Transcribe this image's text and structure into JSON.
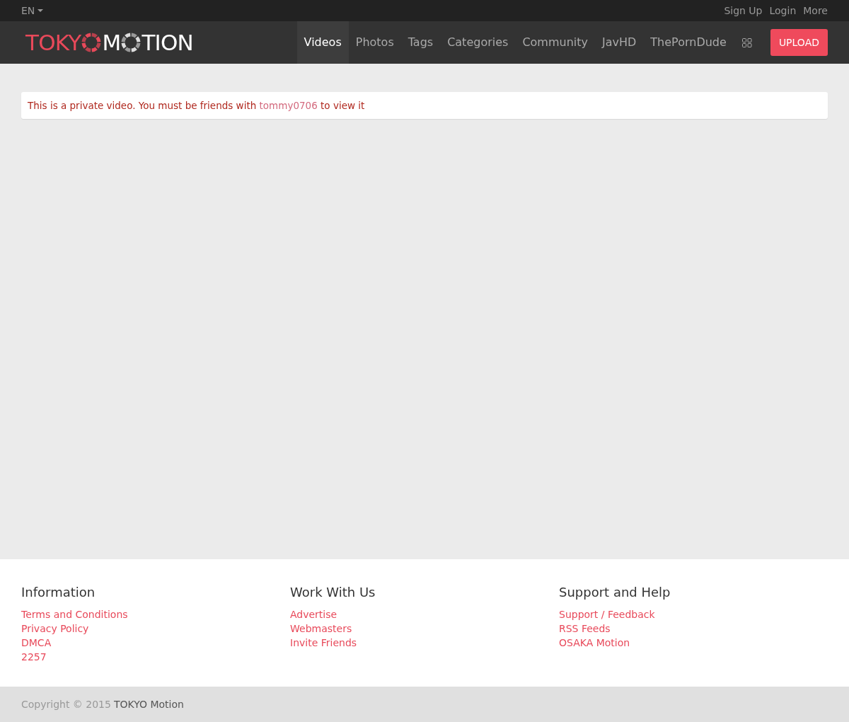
{
  "top_bar": {
    "language": "EN",
    "links": [
      "Sign Up",
      "Login",
      "More"
    ]
  },
  "logo": {
    "part_1": "TOKY",
    "part_2": "M",
    "part_3": "TION"
  },
  "nav": {
    "items": [
      {
        "label": "Videos",
        "selected": true
      },
      {
        "label": "Photos",
        "selected": false
      },
      {
        "label": "Tags",
        "selected": false
      },
      {
        "label": "Categories",
        "selected": false
      },
      {
        "label": "Community",
        "selected": false
      },
      {
        "label": "JavHD",
        "selected": false
      },
      {
        "label": "ThePornDude",
        "selected": false
      }
    ],
    "upload": "UPLOAD"
  },
  "alert": {
    "text_before": "This is a private video. You must be friends with",
    "link": "tommy0706",
    "text_after": "to view it"
  },
  "footer": {
    "columns": [
      {
        "title": "Information",
        "links": [
          "Terms and Conditions",
          "Privacy Policy",
          "DMCA",
          "2257"
        ]
      },
      {
        "title": "Work With Us",
        "links": [
          "Advertise",
          "Webmasters",
          "Invite Friends"
        ]
      },
      {
        "title": "Support and Help",
        "links": [
          "Support / Feedback",
          "RSS Feeds",
          "OSAKA Motion"
        ]
      }
    ]
  },
  "copyright": {
    "text": "Copyright © 2015",
    "link": "TOKYO Motion"
  }
}
